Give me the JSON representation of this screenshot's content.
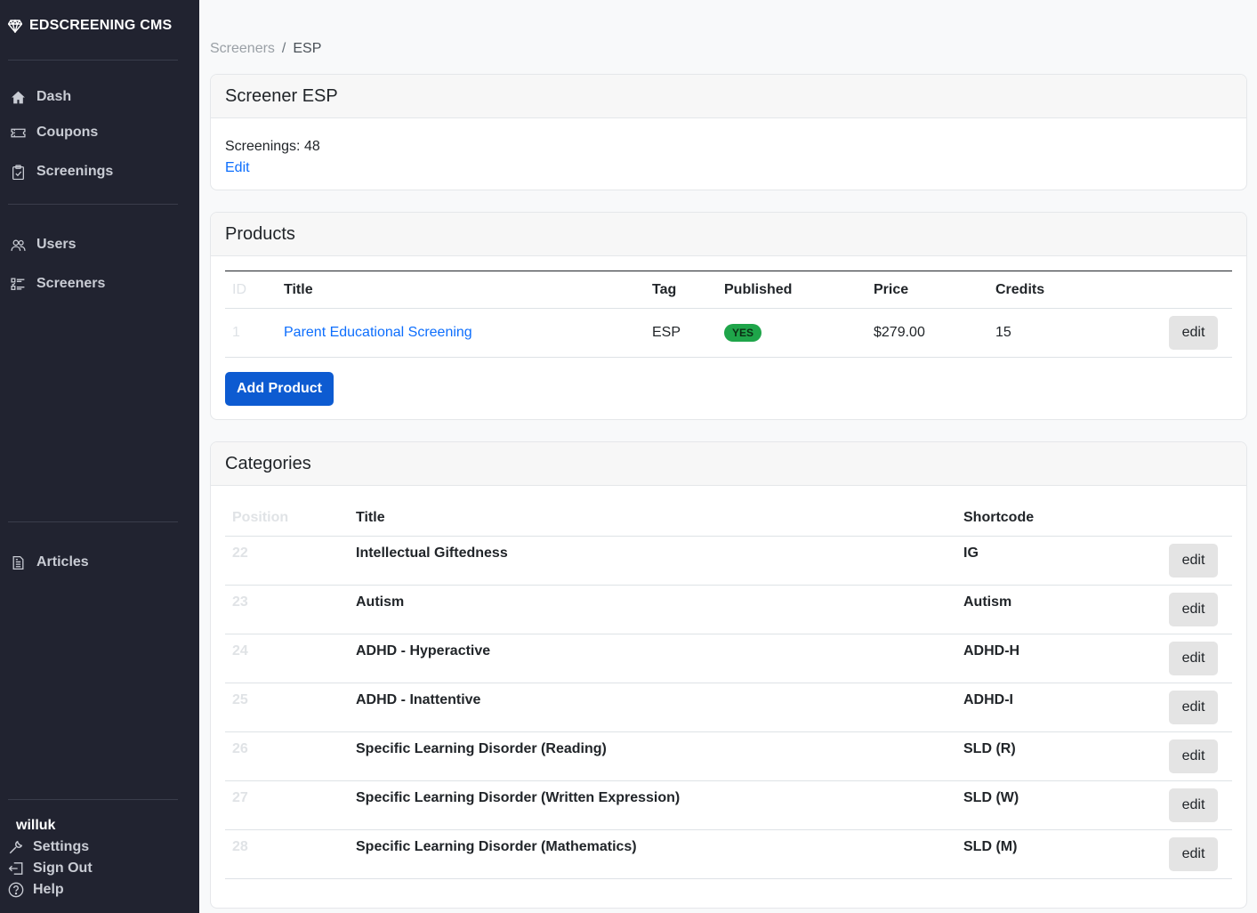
{
  "sidebar": {
    "brand": "EDSCREENING CMS",
    "nav_main": [
      {
        "label": "Dash",
        "icon": "home-icon"
      },
      {
        "label": "Coupons",
        "icon": "ticket-icon"
      },
      {
        "label": "Screenings",
        "icon": "clipboard-icon"
      }
    ],
    "nav_people": [
      {
        "label": "Users",
        "icon": "users-icon"
      },
      {
        "label": "Screeners",
        "icon": "list-icon"
      }
    ],
    "nav_content": [
      {
        "label": "Articles",
        "icon": "document-icon"
      }
    ],
    "user": {
      "name": "willuk",
      "settings": "Settings",
      "sign_out": "Sign Out",
      "help": "Help"
    }
  },
  "breadcrumb": {
    "parent": "Screeners",
    "separator": "/",
    "current": "ESP"
  },
  "screener_card": {
    "title": "Screener ESP",
    "screenings_text": "Screenings: 48",
    "edit_link": "Edit"
  },
  "products": {
    "title": "Products",
    "columns": {
      "id": "ID",
      "title": "Title",
      "tag": "Tag",
      "published": "Published",
      "price": "Price",
      "credits": "Credits"
    },
    "rows": [
      {
        "id": "1",
        "title": "Parent Educational Screening",
        "tag": "ESP",
        "published": "YES",
        "price": "$279.00",
        "credits": "15",
        "edit": "edit"
      }
    ],
    "add_button": "Add Product"
  },
  "categories": {
    "title": "Categories",
    "columns": {
      "position": "Position",
      "title": "Title",
      "shortcode": "Shortcode"
    },
    "rows": [
      {
        "position": "22",
        "title": "Intellectual Giftedness",
        "shortcode": "IG",
        "edit": "edit"
      },
      {
        "position": "23",
        "title": "Autism",
        "shortcode": "Autism",
        "edit": "edit"
      },
      {
        "position": "24",
        "title": "ADHD - Hyperactive",
        "shortcode": "ADHD-H",
        "edit": "edit"
      },
      {
        "position": "25",
        "title": "ADHD - Inattentive",
        "shortcode": "ADHD-I",
        "edit": "edit"
      },
      {
        "position": "26",
        "title": "Specific Learning Disorder (Reading)",
        "shortcode": "SLD (R)",
        "edit": "edit"
      },
      {
        "position": "27",
        "title": "Specific Learning Disorder (Written Expression)",
        "shortcode": "SLD (W)",
        "edit": "edit"
      },
      {
        "position": "28",
        "title": "Specific Learning Disorder (Mathematics)",
        "shortcode": "SLD (M)",
        "edit": "edit"
      }
    ]
  },
  "colors": {
    "sidebar_bg": "#212330",
    "primary": "#0d5bd1",
    "link": "#0d6efd",
    "badge_green": "#1fa54a"
  }
}
